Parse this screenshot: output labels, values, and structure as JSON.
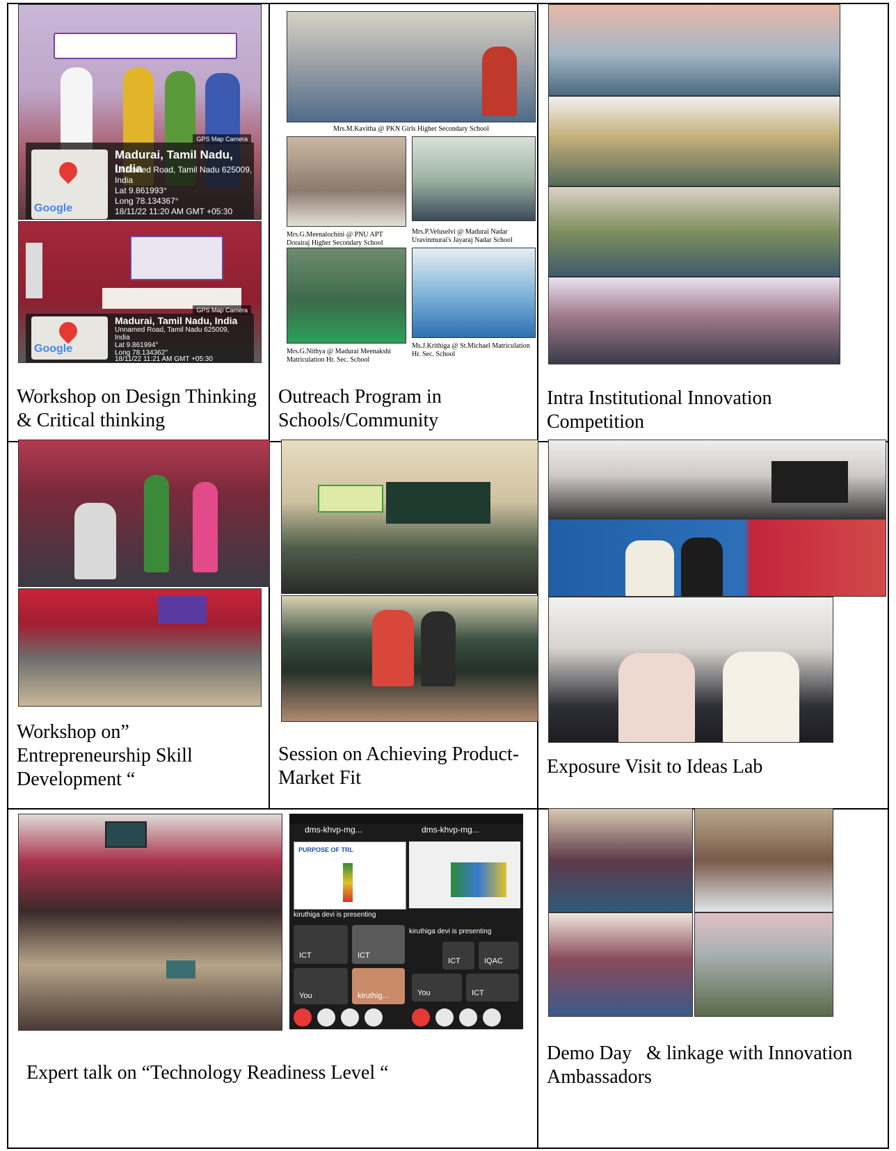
{
  "captions": {
    "r1c1": "Workshop on Design Thinking & Critical thinking",
    "r1c2": "Outreach Program in Schools/Community",
    "r1c3": "Intra Institutional Innovation Competition",
    "r2c1": "Workshop on” Entrepreneurship Skill Development “",
    "r2c2": " Session on Achieving Product-Market Fit",
    "r2c3": "Exposure Visit to Ideas Lab",
    "r3c12": "Expert talk on “Technology Readiness Level “",
    "r3c3": "Demo Day   & linkage with Innovation Ambassadors"
  },
  "geotag_1": {
    "badge": "GPS Map Camera",
    "place": "Madurai, Tamil Nadu, India",
    "address": "Unnamed Road, Tamil Nadu 625009,",
    "country": "India",
    "lat": "Lat 9.861993°",
    "long": "Long 78.134367°",
    "datetime": "18/11/22 11:20 AM GMT +05:30",
    "map_label": "Google"
  },
  "geotag_2": {
    "badge": "GPS Map Camera",
    "place": "Madurai, Tamil Nadu, India",
    "address": "Unnamed Road, Tamil Nadu 625009,",
    "country": "India",
    "lat": "Lat 9.861994°",
    "long": "Long 78.134362°",
    "datetime": "18/11/22 11:21 AM GMT +05:30",
    "map_label": "Google"
  },
  "outreach": {
    "title_main": "Mrs.M.Kavitha @ PKN Girls Higher Secondary School",
    "sub_1": "Mrs.G.Meenalochini @ PNU APT Dorairaj Higher Secondary School",
    "sub_2": "Mrs.P.Veluselvi @ Madurai Nadar Uravinmurai's Jayaraj Nadar School",
    "sub_3": "Mrs.G.Nithya @ Madurai Meenakshi Matriculation Hr. Sec. School",
    "sub_4": "Ms.J.Krithiga @ St.Michael Matriculation Hr. Sec. School"
  },
  "meet": {
    "tab": "dms-khvp-mg...",
    "slide_title": "PURPOSE OF TRL",
    "presenting": "kiruthiga devi is presenting",
    "tiles": [
      "ICT",
      "ICT",
      "You",
      "kiruthig..."
    ],
    "tiles_right": [
      "ICT",
      "IQAC",
      "You",
      "ICT"
    ]
  },
  "colors": {
    "border": "#000000",
    "geotag_bg": "#141414",
    "meet_bg": "#1b1b1b",
    "end_call": "#e53935"
  }
}
